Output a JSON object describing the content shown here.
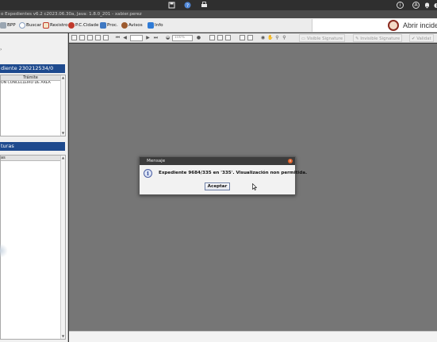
{
  "window": {
    "title": "o Expedientes v6.2 c2023.06.30a, Java: 1.8.0_201 - xabier.perez"
  },
  "system_bar": {
    "icons": [
      "save-icon",
      "help-icon",
      "print-icon",
      "info-circle-icon",
      "account-circle-icon",
      "bell-icon"
    ]
  },
  "menubar": {
    "items": [
      {
        "label": "BPP",
        "icon": "key-icon",
        "color": "#9aa6b2"
      },
      {
        "label": "Buscar",
        "icon": "search-icon",
        "color": "#8aa0c0"
      },
      {
        "label": "Rexistro",
        "icon": "edit-icon",
        "color": "#c0392b"
      },
      {
        "label": "P.C.Cidade",
        "icon": "power-icon",
        "color": "#c0392b"
      },
      {
        "label": "Proc.",
        "icon": "process-icon",
        "color": "#2e7d32"
      },
      {
        "label": "Avisos",
        "icon": "alert-icon",
        "color": "#9c5a2e"
      },
      {
        "label": "Info",
        "icon": "info-icon",
        "color": "#2f7bd6"
      }
    ],
    "open_incident_label": "Abrir inciden"
  },
  "left_panel": {
    "expediente_header": "diente 230212534/0",
    "tramite_column": "Trámite",
    "tramite_rows": [
      "ON CONCELLEIRO DE ÁREA"
    ],
    "facturas_header": "turas",
    "facturas_column": "as"
  },
  "viewer_toolbar": {
    "zoom_placeholder": "100%",
    "visible_signature_label": "Visible Signature",
    "invisible_signature_label": "Invisible Signature",
    "validate_label": "Validat"
  },
  "dialog": {
    "title": "Mensaje",
    "message": "Expediente 9684/335 en '335'. Visualización non permitida.",
    "button_label": "Aceptar"
  }
}
